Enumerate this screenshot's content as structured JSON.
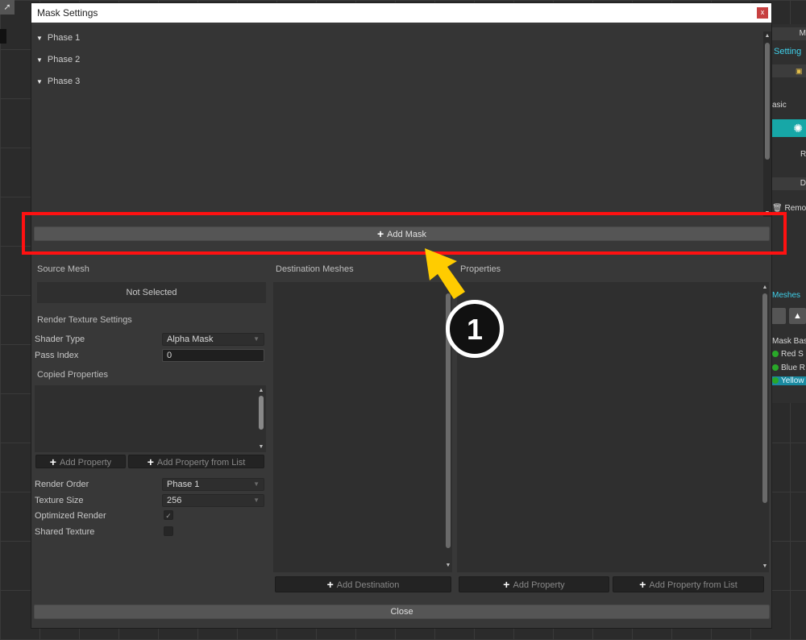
{
  "background": {
    "right_panel": {
      "top_label": "M",
      "setting_label": "Setting",
      "basic_label": "asic",
      "r_label": "R",
      "d_label": "D",
      "remove_label": "Remo",
      "meshes_label": "Meshes",
      "mask_base_label": "Mask Bas",
      "items": [
        {
          "label": "Red S"
        },
        {
          "label": "Blue R"
        },
        {
          "label": "Yellow"
        }
      ]
    }
  },
  "dialog": {
    "title": "Mask Settings",
    "close_glyph": "x",
    "phases": [
      "Phase 1",
      "Phase 2",
      "Phase 3"
    ],
    "add_mask_label": "Add Mask",
    "source_mesh": {
      "header": "Source Mesh",
      "value": "Not Selected",
      "render_texture_settings": "Render Texture Settings",
      "shader_type_label": "Shader Type",
      "shader_type_value": "Alpha Mask",
      "pass_index_label": "Pass Index",
      "pass_index_value": "0",
      "copied_properties": "Copied Properties",
      "add_property_label": "Add Property",
      "add_property_list_label": "Add Property from List",
      "render_order_label": "Render Order",
      "render_order_value": "Phase 1",
      "texture_size_label": "Texture Size",
      "texture_size_value": "256",
      "optimized_render_label": "Optimized Render",
      "optimized_render_checked": true,
      "shared_texture_label": "Shared Texture",
      "shared_texture_checked": false
    },
    "destination": {
      "header": "Destination Meshes",
      "add_destination_label": "Add Destination"
    },
    "properties": {
      "header": "Properties",
      "add_property_label": "Add Property",
      "add_property_list_label": "Add Property from List"
    },
    "close_label": "Close"
  },
  "annotation": {
    "step_number": "1",
    "highlight_color": "#ff1111",
    "arrow_color": "#ffcc00"
  }
}
